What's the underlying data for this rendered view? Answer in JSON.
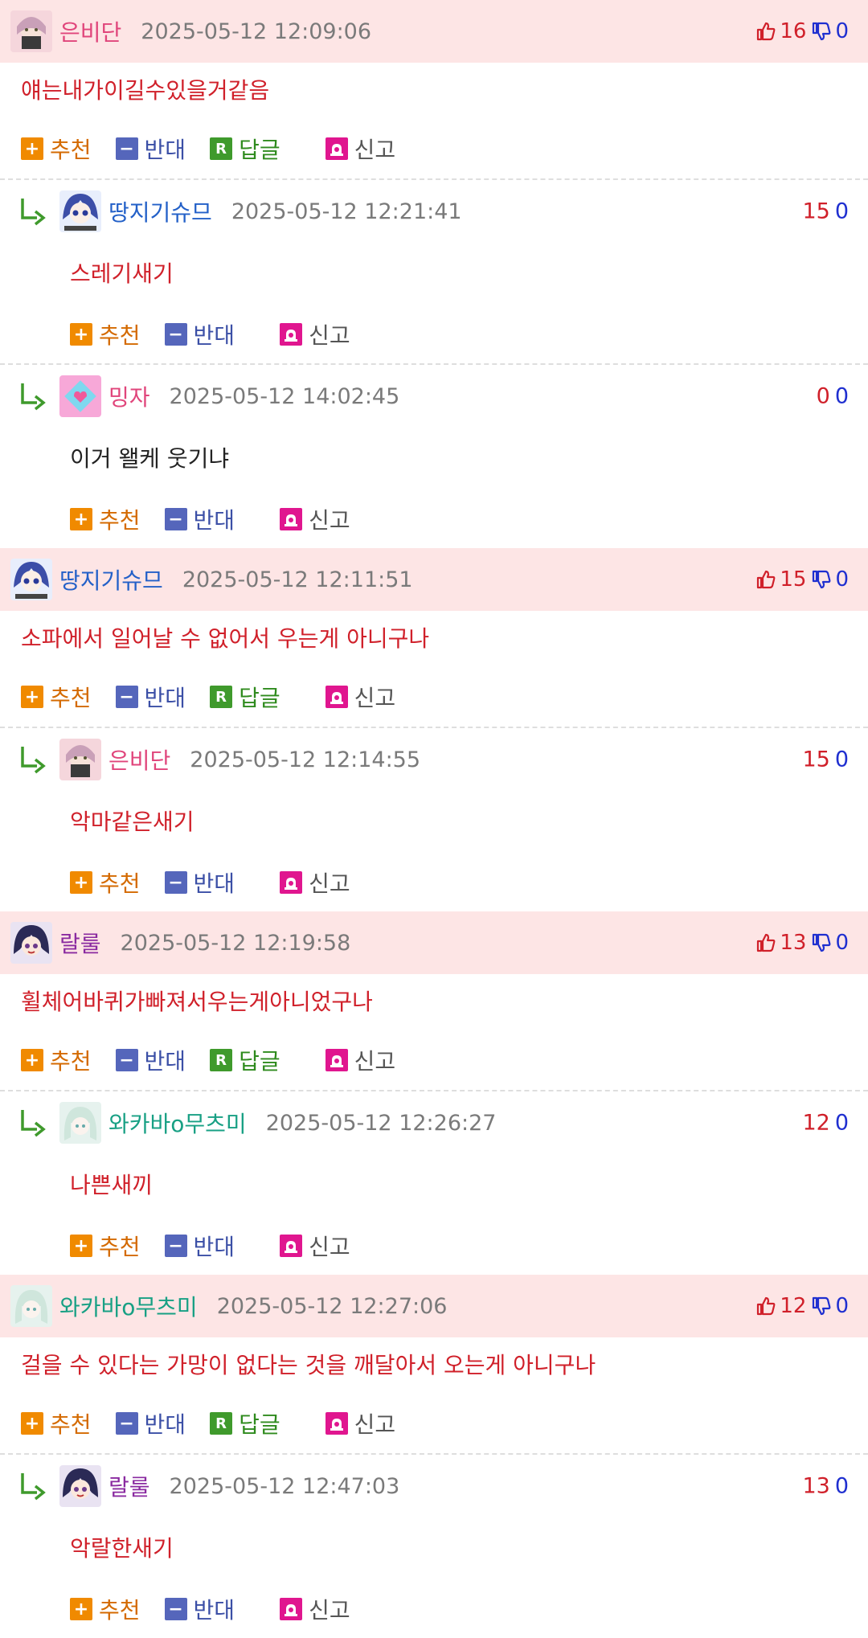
{
  "labels": {
    "recommend": "추천",
    "oppose": "반대",
    "reply": "답글",
    "report": "신고"
  },
  "colors": {
    "header_bg": "#fde5e5",
    "up": "#d0202a",
    "down": "#1f2fd0"
  },
  "comments": [
    {
      "nick": "은비단",
      "nick_color": "#e0457b",
      "date": "2025-05-12 12:09:06",
      "up": "16",
      "down": "0",
      "text": "얘는내가이길수있을거같음",
      "replies": [
        {
          "nick": "땅지기슈므",
          "nick_color": "#2360c8",
          "date": "2025-05-12 12:21:41",
          "up": "15",
          "down": "0",
          "text": "스레기새기"
        },
        {
          "nick": "밍자",
          "nick_color": "#e0457b",
          "date": "2025-05-12 14:02:45",
          "up": "0",
          "down": "0",
          "text": "이거 왤케 웃기냐"
        }
      ]
    },
    {
      "nick": "땅지기슈므",
      "nick_color": "#2360c8",
      "date": "2025-05-12 12:11:51",
      "up": "15",
      "down": "0",
      "text": "소파에서 일어날 수 없어서 우는게 아니구나",
      "replies": [
        {
          "nick": "은비단",
          "nick_color": "#e0457b",
          "date": "2025-05-12 12:14:55",
          "up": "15",
          "down": "0",
          "text": "악마같은새기"
        }
      ]
    },
    {
      "nick": "랄룰",
      "nick_color": "#8a2aa0",
      "date": "2025-05-12 12:19:58",
      "up": "13",
      "down": "0",
      "text": "휠체어바퀴가빠져서우는게아니었구나",
      "replies": [
        {
          "nick": "와카바o무츠미",
          "nick_color": "#18a084",
          "date": "2025-05-12 12:26:27",
          "up": "12",
          "down": "0",
          "text": "나쁜새끼"
        }
      ]
    },
    {
      "nick": "와카바o무츠미",
      "nick_color": "#18a084",
      "date": "2025-05-12 12:27:06",
      "up": "12",
      "down": "0",
      "text": "걸을 수 있다는 가망이 없다는 것을 깨달아서 오는게 아니구나",
      "replies": [
        {
          "nick": "랄룰",
          "nick_color": "#8a2aa0",
          "date": "2025-05-12 12:47:03",
          "up": "13",
          "down": "0",
          "text": "악랄한새기"
        }
      ]
    }
  ]
}
